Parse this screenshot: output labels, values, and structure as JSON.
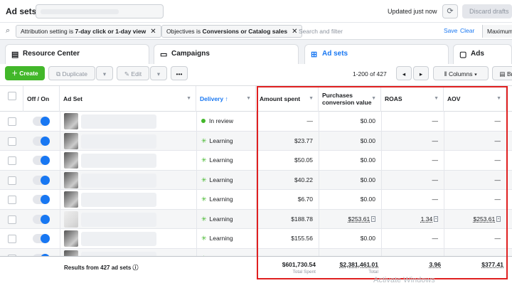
{
  "topbar": {
    "title": "Ad sets",
    "updated": "Updated just now",
    "discard_label": "Discard drafts"
  },
  "filters": {
    "chips": [
      {
        "prefix": "Attribution setting is ",
        "value": "7-day click or 1-day view"
      },
      {
        "prefix": "Objectives is ",
        "value": "Conversions or Catalog sales"
      }
    ],
    "search_placeholder": "Search and filter",
    "save_label": "Save",
    "clear_label": "Clear",
    "maximum_label": "Maximum"
  },
  "tabs": [
    {
      "label": "Resource Center",
      "icon": "book-icon"
    },
    {
      "label": "Campaigns",
      "icon": "folder-icon"
    },
    {
      "label": "Ad sets",
      "icon": "grid-icon",
      "active": true
    },
    {
      "label": "Ads",
      "icon": "ad-icon"
    }
  ],
  "toolbar": {
    "create_label": "Create",
    "duplicate_label": "Duplicate",
    "edit_label": "Edit",
    "more_label": "•••",
    "range": "1-200 of 427",
    "columns_label": "Columns",
    "breakdown_label": "Br"
  },
  "table": {
    "columns": {
      "toggle": "Off / On",
      "adset": "Ad Set",
      "delivery": "Delivery ↑",
      "amount": "Amount spent",
      "purchases_line1": "Purchases",
      "purchases_line2": "conversion value",
      "roas": "ROAS",
      "aov": "AOV"
    },
    "rows": [
      {
        "delivery": "In review",
        "status": "review",
        "amount": "—",
        "purchases": "$0.00",
        "roas": "—",
        "aov": "—"
      },
      {
        "delivery": "Learning",
        "status": "learning",
        "amount": "$23.77",
        "purchases": "$0.00",
        "roas": "—",
        "aov": "—"
      },
      {
        "delivery": "Learning",
        "status": "learning",
        "amount": "$50.05",
        "purchases": "$0.00",
        "roas": "—",
        "aov": "—"
      },
      {
        "delivery": "Learning",
        "status": "learning",
        "amount": "$40.22",
        "purchases": "$0.00",
        "roas": "—",
        "aov": "—"
      },
      {
        "delivery": "Learning",
        "status": "learning",
        "amount": "$6.70",
        "purchases": "$0.00",
        "roas": "—",
        "aov": "—"
      },
      {
        "delivery": "Learning",
        "status": "learning",
        "amount": "$188.78",
        "purchases": "$253.61",
        "roas": "1.34",
        "aov": "$253.61"
      },
      {
        "delivery": "Learning",
        "status": "learning",
        "amount": "$155.56",
        "purchases": "$0.00",
        "roas": "—",
        "aov": "—"
      },
      {
        "delivery": "Learning",
        "status": "learning",
        "amount": "",
        "purchases": "$0.00",
        "roas": "—",
        "aov": "—"
      }
    ],
    "footer": {
      "results": "Results from 427 ad sets",
      "amount": "$601,730.54",
      "amount_sub": "Total Spent",
      "purchases": "$2,381,461.01",
      "purchases_sub": "Total",
      "roas": "3.96",
      "aov": "$377.41"
    }
  },
  "watermark": "Activate Windows",
  "colors": {
    "accent": "#1877f2",
    "create": "#42b72a",
    "highlight": "#e02020"
  }
}
